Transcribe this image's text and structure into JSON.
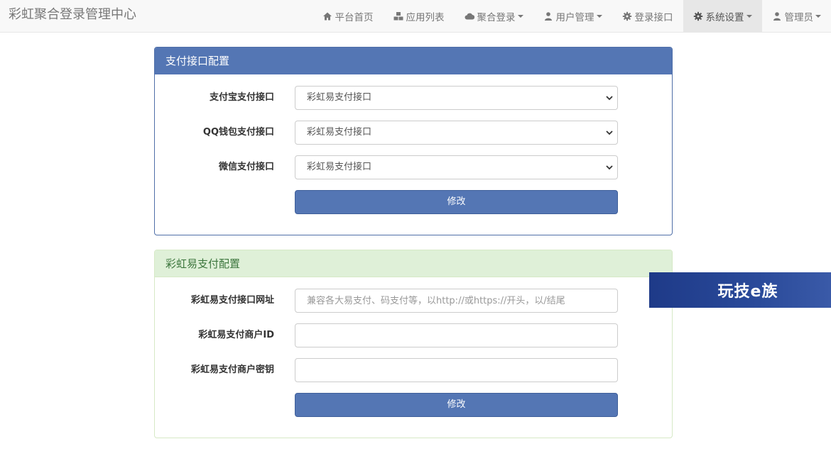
{
  "brand": "彩虹聚合登录管理中心",
  "nav": {
    "items": [
      {
        "label": "平台首页",
        "icon": "home-icon",
        "dropdown": false,
        "active": false
      },
      {
        "label": "应用列表",
        "icon": "cubes-icon",
        "dropdown": false,
        "active": false
      },
      {
        "label": "聚合登录",
        "icon": "cloud-icon",
        "dropdown": true,
        "active": false
      },
      {
        "label": "用户管理",
        "icon": "user-icon",
        "dropdown": true,
        "active": false
      },
      {
        "label": "登录接口",
        "icon": "gear-icon",
        "dropdown": false,
        "active": false
      },
      {
        "label": "系统设置",
        "icon": "cog-icon",
        "dropdown": true,
        "active": true
      },
      {
        "label": "管理员",
        "icon": "user-icon",
        "dropdown": true,
        "active": false
      }
    ]
  },
  "payment_panel": {
    "title": "支付接口配置",
    "fields": [
      {
        "label": "支付宝支付接口",
        "value": "彩虹易支付接口"
      },
      {
        "label": "QQ钱包支付接口",
        "value": "彩虹易支付接口"
      },
      {
        "label": "微信支付接口",
        "value": "彩虹易支付接口"
      }
    ],
    "submit_label": "修改"
  },
  "epay_panel": {
    "title": "彩虹易支付配置",
    "fields": [
      {
        "label": "彩虹易支付接口网址",
        "value": "",
        "placeholder": "兼容各大易支付、码支付等，以http://或https://开头，以/结尾"
      },
      {
        "label": "彩虹易支付商户ID",
        "value": "",
        "placeholder": ""
      },
      {
        "label": "彩虹易支付商户密钥",
        "value": "",
        "placeholder": ""
      }
    ],
    "submit_label": "修改"
  },
  "watermark": "玩技e族",
  "colors": {
    "primary": "#5476b4",
    "success_bg": "#dff0d8",
    "navbar_bg": "#f8f8f8"
  }
}
